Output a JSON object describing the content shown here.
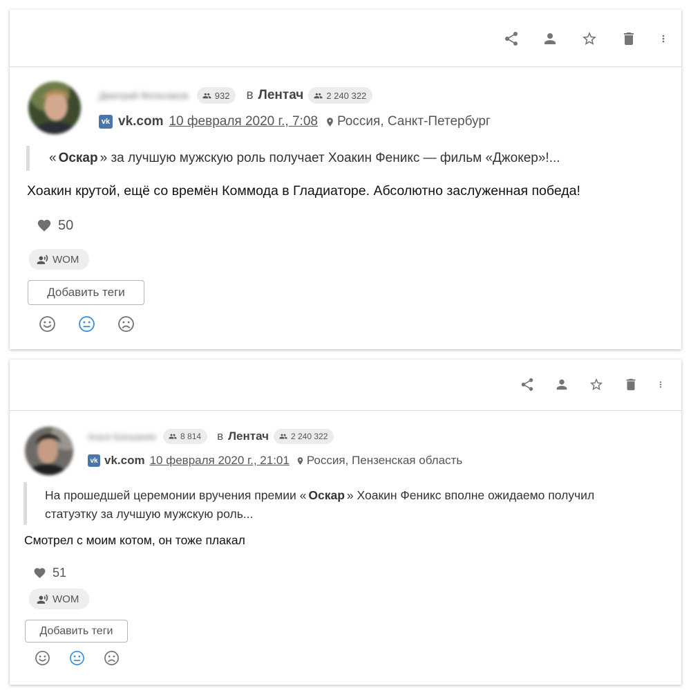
{
  "toolbar": {
    "icons": [
      "share-icon",
      "person-icon",
      "star-icon",
      "trash-icon",
      "more-vert-icon"
    ]
  },
  "posts": [
    {
      "author_name": "Дмитрий Фельчаков",
      "author_followers": "932",
      "in_word": "в",
      "group_name": "Лентач",
      "group_followers": "2 240 322",
      "vk_icon_text": "vk",
      "source": "vk.com",
      "date": "10 февраля 2020 г., 7:08",
      "location": "Россия, Санкт-Петербург",
      "quote_open": "«",
      "quote_bold": "Оскар",
      "quote_close": "»",
      "quote_rest": " за лучшую мужскую роль получает Хоакин Феникс — фильм «Джокер»!...",
      "text": "Хоакин крутой, ещё со времён Коммода в Гладиаторе. Абсолютно заслуженная победа!",
      "likes": "50",
      "wom_label": "WOM",
      "add_tags_label": "Добавить теги",
      "selected_sentiment": "neutral",
      "accent_color": "#3d8fe0"
    },
    {
      "author_name": "Агасе Бахшанян",
      "author_followers": "8 814",
      "in_word": "в",
      "group_name": "Лентач",
      "group_followers": "2 240 322",
      "vk_icon_text": "vk",
      "source": "vk.com",
      "date": "10 февраля 2020 г., 21:01",
      "location": "Россия, Пензенская область",
      "quote_pre": "На прошедшей церемонии вручения премии ",
      "quote_open": "«",
      "quote_bold": "Оскар",
      "quote_close": "»",
      "quote_rest": " Хоакин Феникс вполне ожидаемо получил",
      "quote_line2": "статуэтку за лучшую мужскую роль...",
      "text": "Смотрел с моим котом, он тоже плакал",
      "likes": "51",
      "wom_label": "WOM",
      "add_tags_label": "Добавить теги",
      "selected_sentiment": "neutral",
      "accent_color": "#3d8fe0"
    }
  ]
}
